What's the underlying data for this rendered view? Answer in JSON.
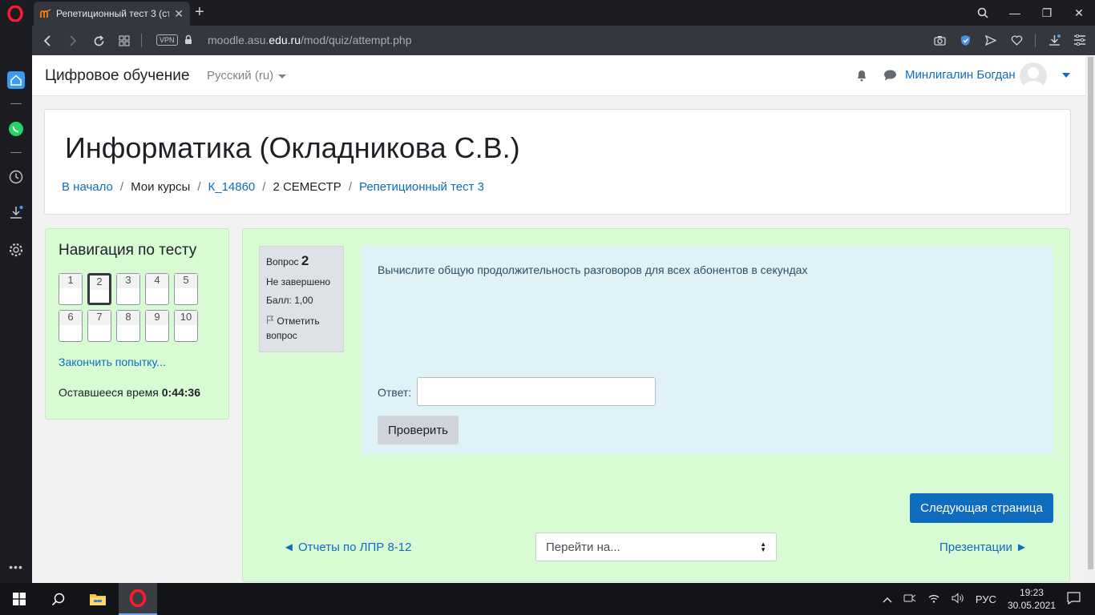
{
  "browser": {
    "tab_title": "Репетиционный тест 3 (ст",
    "url_prefix": "moodle.asu.",
    "url_domain": "edu.ru",
    "url_path": "/mod/quiz/attempt.php",
    "vpn_label": "VPN"
  },
  "navbar": {
    "site_name": "Цифровое обучение",
    "language": "Русский (ru)",
    "user_name": "Минлигалин Богдан"
  },
  "header": {
    "course_title": "Информатика (Окладникова С.В.)",
    "breadcrumb": [
      {
        "label": "В начало"
      },
      {
        "label": "Мои курсы"
      },
      {
        "label": "К_14860"
      },
      {
        "label": "2 СЕМЕСТР"
      },
      {
        "label": "Репетиционный тест 3"
      }
    ]
  },
  "quiz_nav": {
    "title": "Навигация по тесту",
    "questions": [
      "1",
      "2",
      "3",
      "4",
      "5",
      "6",
      "7",
      "8",
      "9",
      "10"
    ],
    "current_question": "2",
    "finish_link": "Закончить попытку...",
    "time_label": "Оставшееся время",
    "time_value": "0:44:36"
  },
  "question": {
    "label": "Вопрос",
    "number": "2",
    "status": "Не завершено",
    "grade": "Балл: 1,00",
    "flag_line1": "Отметить",
    "flag_line2": "вопрос",
    "text": "Вычислите общую продолжительность разговоров для всех абонентов в секундах",
    "answer_label": "Ответ:",
    "answer_value": "",
    "check_button": "Проверить"
  },
  "footer_nav": {
    "next_page_button": "Следующая страница",
    "prev_link": "◄ Отчеты по ЛПР 8-12",
    "jump_select": "Перейти на...",
    "next_link": "Презентации ►"
  },
  "taskbar": {
    "language": "РУС",
    "time": "19:23",
    "date": "30.05.2021"
  },
  "colors": {
    "accent": "#0f6cbf",
    "block_bg": "#d8fbd4",
    "question_bg": "#def2f8"
  }
}
